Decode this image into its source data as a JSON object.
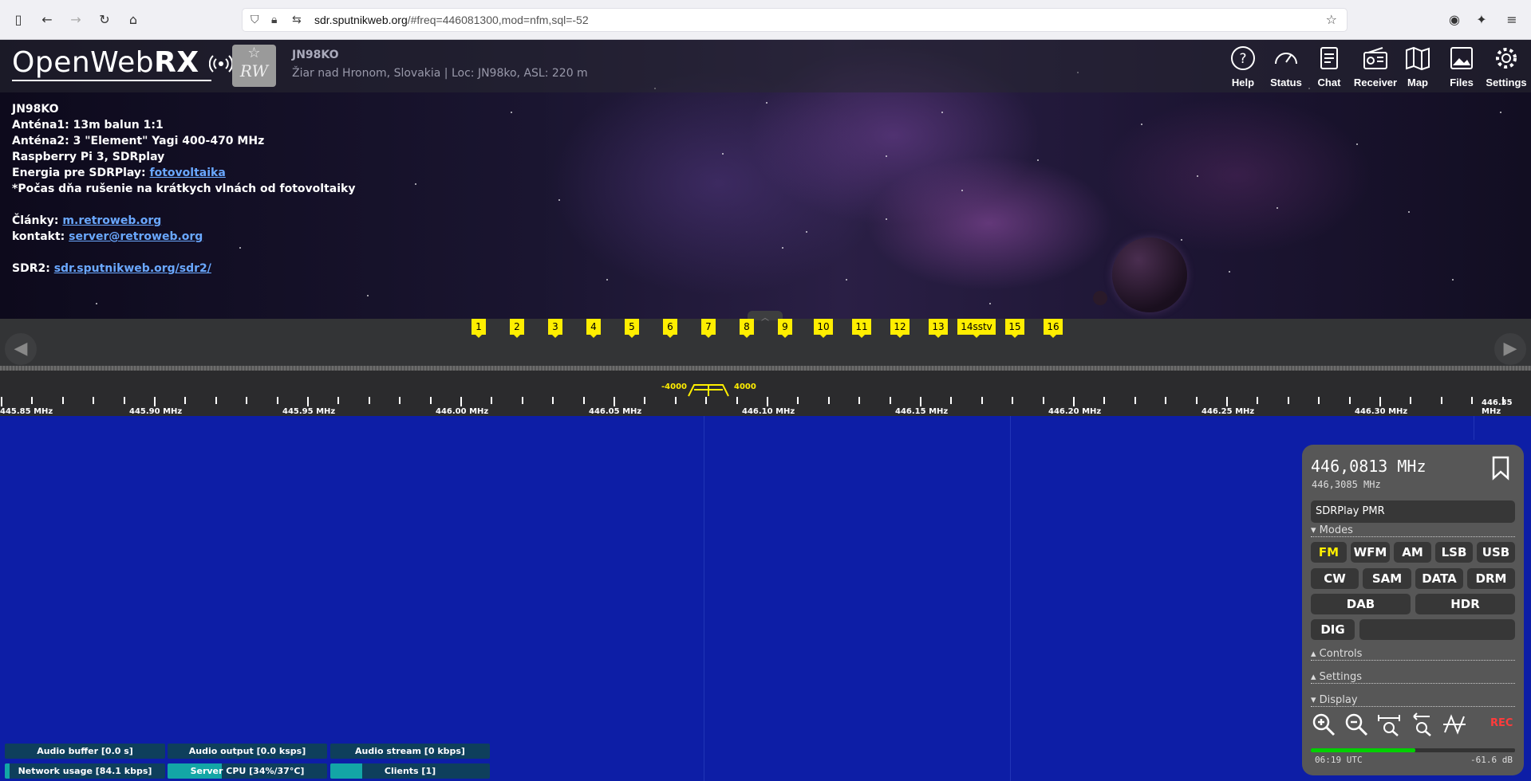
{
  "browser": {
    "url_domain": "sdr.sputnikweb.org",
    "url_rest": "/#freq=446081300,mod=nfm,sql=-52"
  },
  "header": {
    "logo_text": "OpenWeb",
    "logo_rx": "RX",
    "rw_star": "☆",
    "rw_text": "RW",
    "receiver_name": "JN98KO",
    "receiver_desc": "Žiar nad Hronom, Slovakia | Loc: JN98ko, ASL: 220 m",
    "buttons": [
      {
        "label": "Help",
        "icon": "help-icon"
      },
      {
        "label": "Status",
        "icon": "status-icon"
      },
      {
        "label": "Chat",
        "icon": "chat-icon"
      },
      {
        "label": "Receiver",
        "icon": "receiver-icon"
      },
      {
        "label": "Map",
        "icon": "map-icon"
      },
      {
        "label": "Files",
        "icon": "files-icon"
      },
      {
        "label": "Settings",
        "icon": "settings-icon"
      }
    ]
  },
  "info": {
    "line1": "JN98KO",
    "line2": "Anténa1: 13m balun 1:1",
    "line3": "Anténa2: 3 \"Element\" Yagi 400-470 MHz",
    "line4": "Raspberry Pi 3, SDRplay",
    "line5_prefix": "Energia pre SDRPlay: ",
    "line5_link": "fotovoltaika",
    "line6": "*Počas dňa rušenie na krátkych vlnách od fotovoltaiky",
    "line7_prefix": "Články: ",
    "line7_link": "m.retroweb.org",
    "line8_prefix": "kontakt: ",
    "line8_link": "server@retroweb.org",
    "line9_prefix": "SDR2: ",
    "line9_link": "sdr.sputnikweb.org/sdr2/"
  },
  "bookmarks": [
    "1",
    "2",
    "3",
    "4",
    "5",
    "6",
    "7",
    "8",
    "9",
    "10",
    "11",
    "12",
    "13",
    "14sstv",
    "15",
    "16"
  ],
  "scale": {
    "labels": [
      "445.85 MHz",
      "445.90 MHz",
      "445.95 MHz",
      "446.00 MHz",
      "446.05 MHz",
      "446.10 MHz",
      "446.15 MHz",
      "446.20 MHz",
      "446.25 MHz",
      "446.30 MHz",
      "446.35 MHz"
    ],
    "filter_low": "-4000",
    "filter_high": "4000"
  },
  "status": {
    "audio_buffer": "Audio buffer [0.0 s]",
    "audio_output": "Audio output [0.0 ksps]",
    "audio_stream": "Audio stream [0 kbps]",
    "network": "Network usage [84.1 kbps]",
    "cpu": "Server CPU [34%/37°C]",
    "clients": "Clients [1]",
    "network_level": 0.03,
    "cpu_level": 0.34,
    "clients_level": 0.2
  },
  "panel": {
    "freq_main": "446,0813 MHz",
    "freq_sub": "446,3085 MHz",
    "profile": "SDRPlay PMR",
    "modes_header": "▾ Modes",
    "modes_row1": [
      "FM",
      "WFM",
      "AM",
      "LSB",
      "USB"
    ],
    "modes_row2": [
      "CW",
      "SAM",
      "DATA",
      "DRM"
    ],
    "modes_row3": [
      "DAB",
      "HDR"
    ],
    "mode_dig": "DIG",
    "active_mode": "FM",
    "controls_header": "▴ Controls",
    "settings_header": "▴ Settings",
    "display_header": "▾ Display",
    "rec": "REC",
    "clock": "06:19 UTC",
    "level": "-61.6 dB",
    "smeter_level": 0.51
  },
  "colors": {
    "accent_yellow": "#ffee00",
    "waterfall": "#0d1ea6",
    "panel": "#575757",
    "status_fill": "#13a6a6",
    "status_bg": "#0e3f5c"
  }
}
